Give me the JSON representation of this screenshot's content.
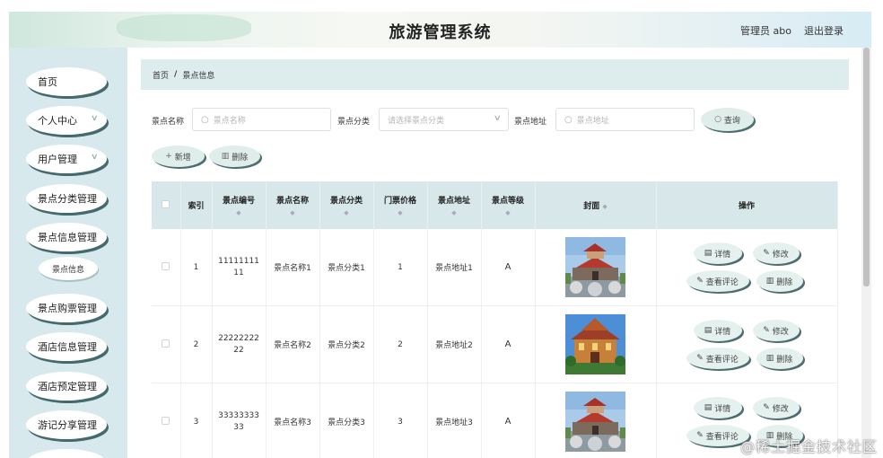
{
  "header": {
    "title": "旅游管理系统",
    "user_label": "管理员 abo",
    "logout_label": "退出登录"
  },
  "sidebar": {
    "items": [
      {
        "label": "首页",
        "chevron": false
      },
      {
        "label": "个人中心",
        "chevron": true
      },
      {
        "label": "用户管理",
        "chevron": true
      },
      {
        "label": "景点分类管理",
        "chevron": false
      },
      {
        "label": "景点信息管理",
        "chevron": false
      },
      {
        "label": "景点购票管理",
        "chevron": false
      },
      {
        "label": "酒店信息管理",
        "chevron": false
      },
      {
        "label": "酒店预定管理",
        "chevron": false
      },
      {
        "label": "游记分享管理",
        "chevron": false
      }
    ],
    "sub_item": "景点信息"
  },
  "breadcrumb": {
    "home": "首页",
    "separator": "/",
    "current": "景点信息"
  },
  "search": {
    "name_label": "景点名称",
    "name_placeholder": "景点名称",
    "category_label": "景点分类",
    "category_placeholder": "请选择景点分类",
    "address_label": "景点地址",
    "address_placeholder": "景点地址",
    "query_label": "查询"
  },
  "toolbar": {
    "add_label": "新增",
    "delete_label": "删除"
  },
  "table": {
    "headers": {
      "index": "索引",
      "code": "景点编号",
      "name": "景点名称",
      "category": "景点分类",
      "price": "门票价格",
      "address": "景点地址",
      "level": "景点等级",
      "cover": "封面",
      "ops": "操作"
    },
    "rows": [
      {
        "index": "1",
        "code": "1111111111",
        "name": "景点名称1",
        "category": "景点分类1",
        "price": "1",
        "address": "景点地址1",
        "level": "A",
        "cover": "pagoda"
      },
      {
        "index": "2",
        "code": "2222222222",
        "name": "景点名称2",
        "category": "景点分类2",
        "price": "2",
        "address": "景点地址2",
        "level": "A",
        "cover": "temple"
      },
      {
        "index": "3",
        "code": "3333333333",
        "name": "景点名称3",
        "category": "景点分类3",
        "price": "3",
        "address": "景点地址3",
        "level": "A",
        "cover": "pagoda"
      }
    ],
    "actions": {
      "detail": "详情",
      "edit": "修改",
      "comments": "查看评论",
      "delete": "删除"
    }
  },
  "watermark": "@稀土掘金技术社区",
  "colors": {
    "accent_pill": "#dfeeea",
    "pill_shadow": "#4f6d70",
    "sidebar_bg": "#d7e9ec",
    "header_row_bg": "#d8e8ea"
  },
  "icons": [
    "search-icon",
    "chevron-down-icon",
    "plus-icon",
    "trash-icon",
    "document-icon",
    "edit-icon"
  ]
}
